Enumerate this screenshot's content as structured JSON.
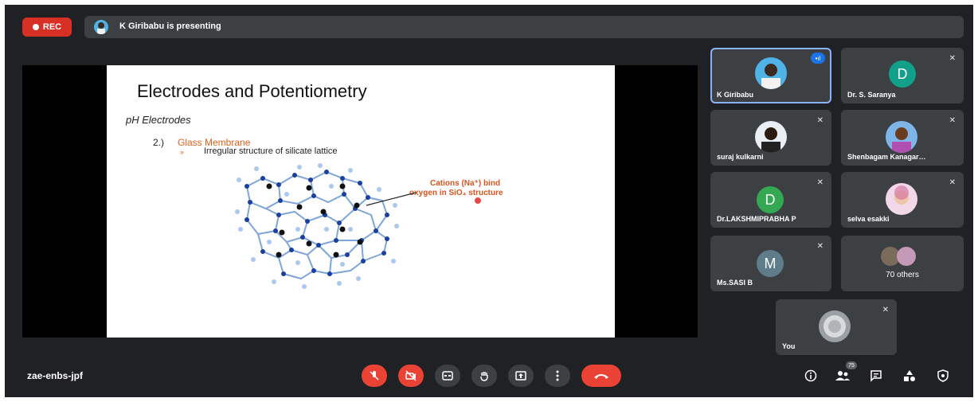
{
  "meeting": {
    "rec_label": "REC",
    "presenting_text": "K Giribabu is presenting",
    "meeting_code": "zae-enbs-jpf"
  },
  "slide": {
    "title": "Electrodes and Potentiometry",
    "subtitle": "pH Electrodes",
    "item_number": "2.)",
    "item_title": "Glass Membrane",
    "bullet": "»",
    "bullet_text": "Irregular structure of silicate lattice",
    "annotation_line1": "Cations (Na⁺) bind",
    "annotation_line2": "oxygen in SiO₄ structure"
  },
  "participants": [
    {
      "name": "K Giribabu",
      "avatar": "photo",
      "speaking": true
    },
    {
      "name": "Dr. S. Saranya",
      "avatar_letter": "D",
      "color": "#12a08a",
      "muted": true
    },
    {
      "name": "suraj kulkarni",
      "avatar": "photo",
      "muted": true
    },
    {
      "name": "Shenbagam Kanagar…",
      "avatar": "photo",
      "muted": true
    },
    {
      "name": "Dr.LAKSHMIPRABHA P",
      "avatar_letter": "D",
      "color": "#34a853",
      "muted": true
    },
    {
      "name": "selva esakki",
      "avatar": "photo",
      "muted": true
    },
    {
      "name": "Ms.SASI B",
      "avatar_letter": "M",
      "color": "#5f7c8a",
      "muted": true
    },
    {
      "name": "70 others",
      "avatar": "group"
    },
    {
      "name": "You",
      "avatar": "photo",
      "muted": true
    }
  ],
  "toolbar": {
    "people_count": "75",
    "buttons": [
      "mic-off",
      "camera-off",
      "captions",
      "raise-hand",
      "present",
      "more",
      "end-call"
    ]
  },
  "colors": {
    "background": "#202124",
    "tile": "#3c4043",
    "red": "#ea4335",
    "speaking_border": "#8ab4f8"
  }
}
